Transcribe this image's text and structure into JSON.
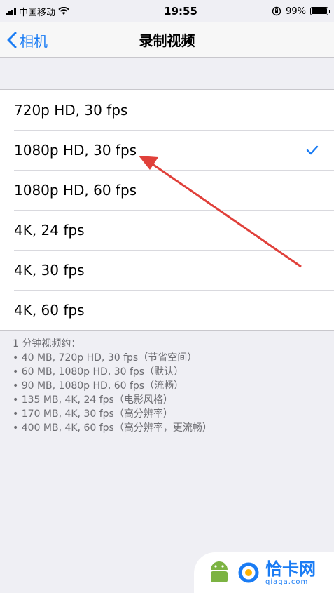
{
  "status": {
    "carrier": "中国移动",
    "time": "19:55",
    "battery": "99%",
    "battery_level": 0.99
  },
  "nav": {
    "back_label": "相机",
    "title": "录制视频"
  },
  "options": [
    {
      "label": "720p HD, 30 fps",
      "selected": false
    },
    {
      "label": "1080p HD, 30 fps",
      "selected": true
    },
    {
      "label": "1080p HD, 60 fps",
      "selected": false
    },
    {
      "label": "4K, 24 fps",
      "selected": false
    },
    {
      "label": "4K, 30 fps",
      "selected": false
    },
    {
      "label": "4K, 60 fps",
      "selected": false
    }
  ],
  "footer": {
    "heading": "1 分钟视频约：",
    "lines": [
      "• 40 MB, 720p HD, 30 fps（节省空间）",
      "• 60 MB, 1080p HD, 30 fps（默认）",
      "• 90 MB, 1080p HD, 60 fps（流畅）",
      "• 135 MB, 4K, 24 fps（电影风格）",
      "• 170 MB, 4K, 30 fps（高分辨率）",
      "• 400 MB, 4K, 60 fps（高分辨率，更流畅）"
    ]
  },
  "watermark": {
    "title": "恰卡网",
    "url": "qiaqa.com"
  },
  "colors": {
    "accent": "#1a7cf4",
    "arrow": "#e0403a",
    "background": "#efeff4"
  }
}
